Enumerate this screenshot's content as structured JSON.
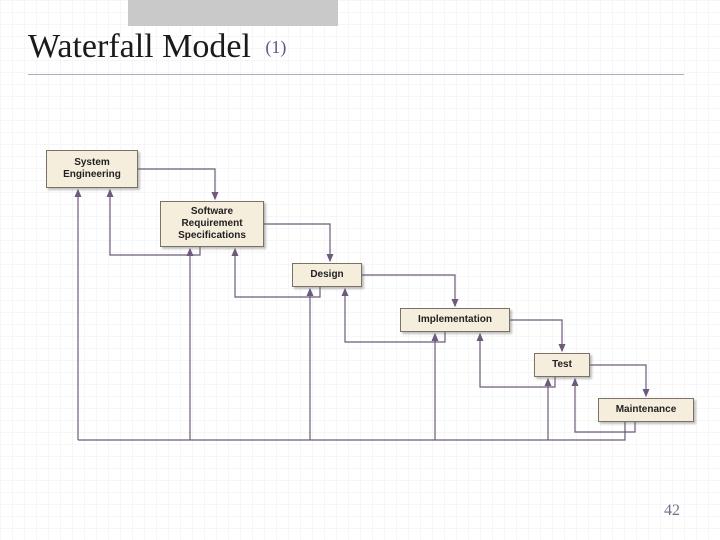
{
  "title": {
    "main": "Waterfall Model",
    "sub": "(1)"
  },
  "stages": [
    {
      "id": "system-engineering",
      "label": "System\nEngineering"
    },
    {
      "id": "srs",
      "label": "Software\nRequirement\nSpecifications"
    },
    {
      "id": "design",
      "label": "Design"
    },
    {
      "id": "implementation",
      "label": "Implementation"
    },
    {
      "id": "test",
      "label": "Test"
    },
    {
      "id": "maintenance",
      "label": "Maintenance"
    }
  ],
  "footer": {
    "page_number": "42"
  },
  "colors": {
    "box_fill": "#f5eedd",
    "box_border": "#7a7265",
    "arrow": "#6e5a7a",
    "title": "#1a1a1a",
    "subtitle": "#5a5a8a"
  }
}
